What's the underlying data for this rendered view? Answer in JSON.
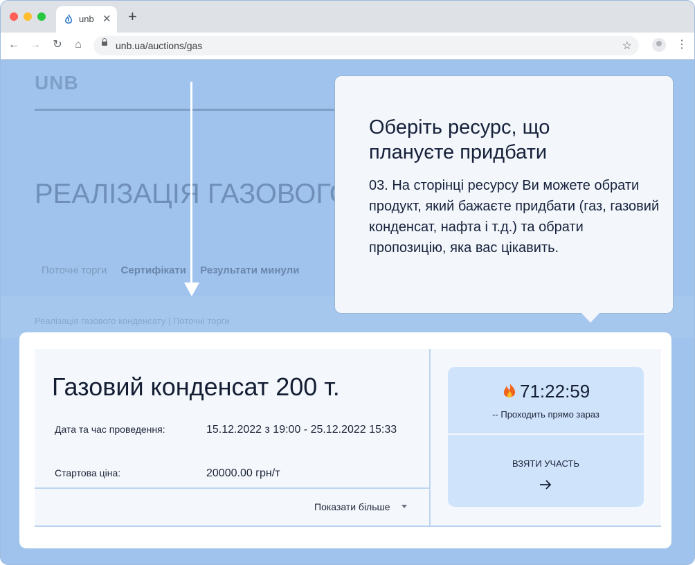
{
  "browser": {
    "tab_title": "unb",
    "url": "unb.ua/auctions/gas"
  },
  "page": {
    "logo": "UNB",
    "heading": "РЕАЛІЗАЦІЯ ГАЗОВОГО",
    "tabs": [
      "Поточні торги",
      "Сертифікати",
      "Результати минули"
    ],
    "breadcrumb": "Реалізація газового конденсату | Поточні торги"
  },
  "callout": {
    "title": "Оберіть ресурс, що плануєте придбати",
    "text": "03.  На сторінці ресурсу Ви можете обрати продукт, який бажаєте придбати (газ, газовий конденсат, нафта і т.д.) та обрати пропозицію, яка вас цікавить."
  },
  "auction": {
    "title": "Газовий конденсат 200 т.",
    "date_label": "Дата та час проведення:",
    "date_value": "15.12.2022  з 19:00 - 25.12.2022 15:33",
    "price_label": "Стартова ціна:",
    "price_value": "20000.00 грн/т",
    "show_more": "Показати більше",
    "timer": "71:22:59",
    "status": "-- Проходить прямо зараз",
    "join_label": "ВЗЯТИ УЧАСТЬ"
  },
  "colors": {
    "overlay": "#9fc3ec",
    "card_bg": "#f4f7fc",
    "timer_bg": "#cfe3fb",
    "text_dark": "#141e33"
  }
}
